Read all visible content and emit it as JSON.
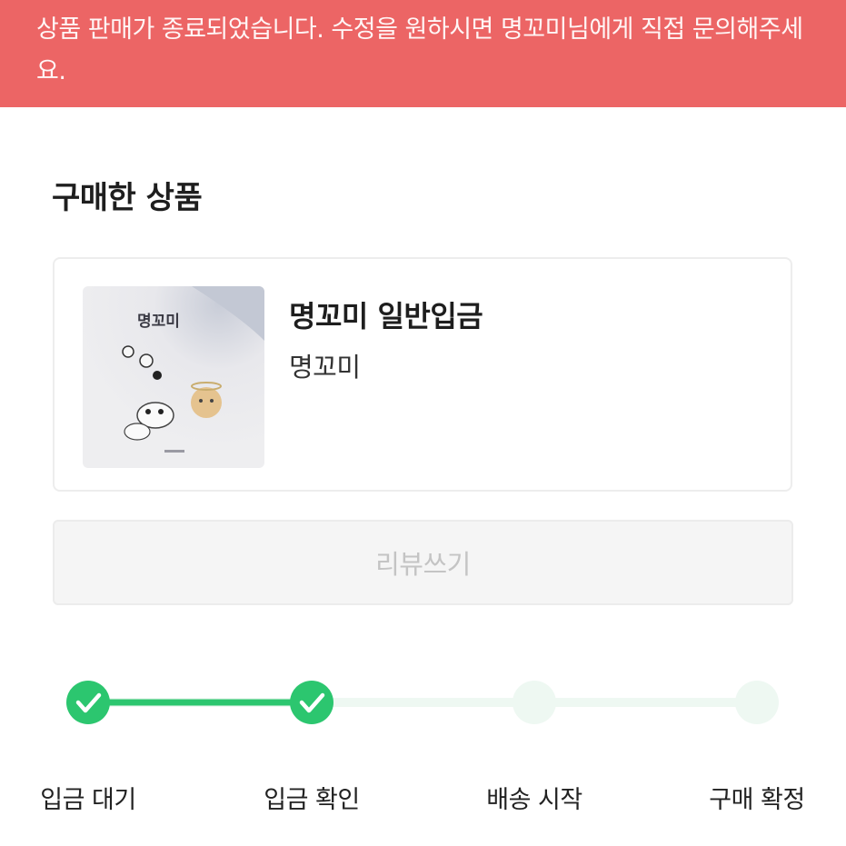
{
  "banner": {
    "message": "상품 판매가 종료되었습니다. 수정을 원하시면 명꼬미님에게 직접 문의해주세요.",
    "background_color": "#ec6565"
  },
  "purchased": {
    "section_title": "구매한 상품",
    "product": {
      "name": "명꼬미 일반입금",
      "seller": "명꼬미",
      "thumbnail_text": "명꼬미"
    },
    "review_button_label": "리뷰쓰기"
  },
  "order_progress": {
    "accent_color": "#2cc66f",
    "inactive_color": "#eef8f2",
    "current_step": 2,
    "steps": [
      {
        "label": "입금 대기",
        "completed": true
      },
      {
        "label": "입금 확인",
        "completed": true
      },
      {
        "label": "배송 시작",
        "completed": false
      },
      {
        "label": "구매 확정",
        "completed": false
      }
    ]
  }
}
